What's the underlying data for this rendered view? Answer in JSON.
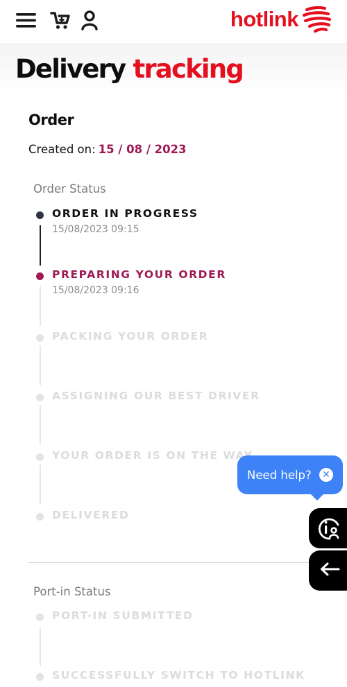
{
  "header": {
    "menu_icon": "hamburger-menu-icon",
    "cart_icon": "shopping-cart-icon",
    "user_icon": "user-account-icon",
    "brand_name": "hotlink",
    "brand_color": "#e4101f"
  },
  "page": {
    "title_main": "Delivery",
    "title_accent": "tracking"
  },
  "order": {
    "heading": "Order",
    "created_label": "Created on:",
    "created_date": "15 / 08 / 2023"
  },
  "order_status": {
    "label": "Order Status",
    "steps": [
      {
        "label": "ORDER IN PROGRESS",
        "time": "15/08/2023 09:15",
        "state": "done"
      },
      {
        "label": "PREPARING YOUR ORDER",
        "time": "15/08/2023 09:16",
        "state": "active"
      },
      {
        "label": "PACKING YOUR ORDER",
        "time": "",
        "state": "pending"
      },
      {
        "label": "ASSIGNING OUR BEST DRIVER",
        "time": "",
        "state": "pending"
      },
      {
        "label": "YOUR ORDER IS ON THE WAY",
        "time": "",
        "state": "pending"
      },
      {
        "label": "DELIVERED",
        "time": "",
        "state": "pending"
      }
    ]
  },
  "portin_status": {
    "label": "Port-in Status",
    "steps": [
      {
        "label": "PORT-IN SUBMITTED",
        "state": "pending"
      },
      {
        "label": "SUCCESSFULLY SWITCH TO HOTLINK",
        "state": "pending"
      }
    ]
  },
  "help": {
    "bubble_text": "Need help?",
    "close_icon": "close-circle-icon",
    "chat_icon": "help-assistant-icon",
    "back_icon": "arrow-left-icon",
    "bubble_color": "#3d82f7"
  },
  "colors": {
    "accent_purple": "#9e1a55",
    "done_dot": "#2e3442",
    "pending": "#dcdcdc"
  }
}
